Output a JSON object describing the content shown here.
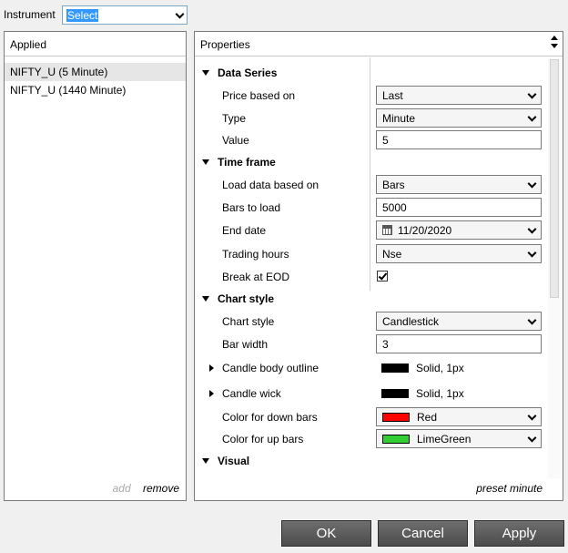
{
  "instrument": {
    "label": "Instrument",
    "value": "Select"
  },
  "applied": {
    "title": "Applied",
    "items": [
      "NIFTY_U (5 Minute)",
      "NIFTY_U (1440 Minute)"
    ],
    "add_label": "add",
    "remove_label": "remove"
  },
  "properties": {
    "title": "Properties",
    "data_series": {
      "title": "Data Series",
      "price_based_on": {
        "label": "Price based on",
        "value": "Last"
      },
      "type": {
        "label": "Type",
        "value": "Minute"
      },
      "value": {
        "label": "Value",
        "value": "5"
      }
    },
    "time_frame": {
      "title": "Time frame",
      "load_data_based_on": {
        "label": "Load data based on",
        "value": "Bars"
      },
      "bars_to_load": {
        "label": "Bars to load",
        "value": "5000"
      },
      "end_date": {
        "label": "End date",
        "value": "11/20/2020"
      },
      "trading_hours": {
        "label": "Trading hours",
        "value": "Nse"
      },
      "break_at_eod": {
        "label": "Break at EOD",
        "checked": true
      }
    },
    "chart_style": {
      "title": "Chart style",
      "chart_style": {
        "label": "Chart style",
        "value": "Candlestick"
      },
      "bar_width": {
        "label": "Bar width",
        "value": "3"
      },
      "candle_body_outline": {
        "label": "Candle body outline",
        "value": "Solid, 1px",
        "color": "#000000"
      },
      "candle_wick": {
        "label": "Candle wick",
        "value": "Solid, 1px",
        "color": "#000000"
      },
      "color_down_bars": {
        "label": "Color for down bars",
        "value": "Red",
        "color": "#ff0000"
      },
      "color_up_bars": {
        "label": "Color for up bars",
        "value": "LimeGreen",
        "color": "#32cd32"
      }
    },
    "visual": {
      "title": "Visual"
    },
    "preset_label": "preset minute"
  },
  "buttons": {
    "ok": "OK",
    "cancel": "Cancel",
    "apply": "Apply"
  }
}
